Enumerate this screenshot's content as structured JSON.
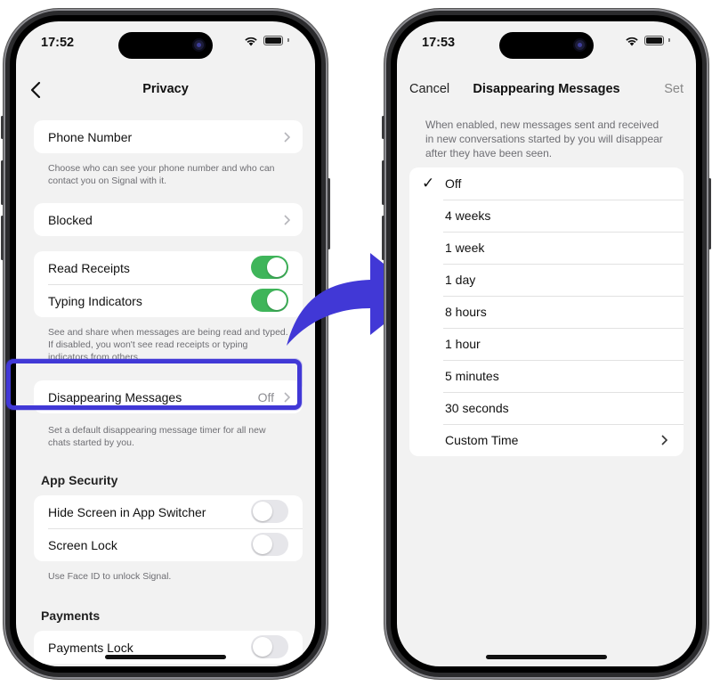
{
  "left_phone": {
    "time": "17:52",
    "title": "Privacy",
    "phone_number": {
      "label": "Phone Number",
      "footnote": "Choose who can see your phone number and who can contact you on Signal with it."
    },
    "blocked": {
      "label": "Blocked"
    },
    "read_receipts": {
      "label": "Read Receipts",
      "on": true
    },
    "typing_indicators": {
      "label": "Typing Indicators",
      "on": true
    },
    "receipts_footnote": "See and share when messages are being read and typed. If disabled, you won't see read receipts or typing indicators from others.",
    "disappearing": {
      "label": "Disappearing Messages",
      "value": "Off",
      "footnote": "Set a default disappearing message timer for all new chats started by you."
    },
    "app_security": {
      "heading": "App Security",
      "hide_screen": {
        "label": "Hide Screen in App Switcher",
        "on": false
      },
      "screen_lock": {
        "label": "Screen Lock",
        "on": false
      },
      "footnote": "Use Face ID to unlock Signal."
    },
    "payments": {
      "heading": "Payments",
      "payments_lock": {
        "label": "Payments Lock",
        "on": false
      }
    }
  },
  "right_phone": {
    "time": "17:53",
    "cancel": "Cancel",
    "title": "Disappearing Messages",
    "set": "Set",
    "description": "When enabled, new messages sent and received in new conversations started by you will disappear after they have been seen.",
    "options": [
      "Off",
      "4 weeks",
      "1 week",
      "1 day",
      "8 hours",
      "1 hour",
      "5 minutes",
      "30 seconds",
      "Custom Time"
    ],
    "selected": "Off",
    "check_glyph": "✓"
  },
  "colors": {
    "highlight": "#4138d6",
    "arrow": "#4138d6",
    "toggle_on": "#3fb55a"
  }
}
